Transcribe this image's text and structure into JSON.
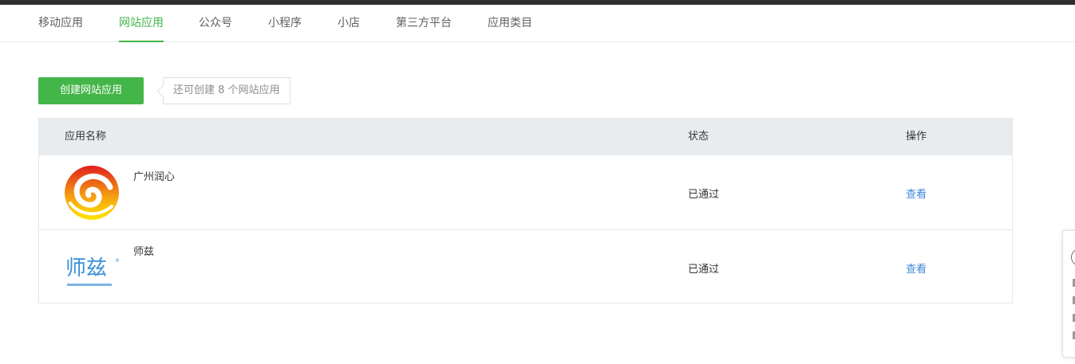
{
  "nav": {
    "tabs": [
      {
        "label": "移动应用",
        "active": false
      },
      {
        "label": "网站应用",
        "active": true
      },
      {
        "label": "公众号",
        "active": false
      },
      {
        "label": "小程序",
        "active": false
      },
      {
        "label": "小店",
        "active": false
      },
      {
        "label": "第三方平台",
        "active": false
      },
      {
        "label": "应用类目",
        "active": false
      }
    ]
  },
  "toolbar": {
    "create_label": "创建网站应用",
    "tip": "还可创建 8 个网站应用"
  },
  "table": {
    "headers": {
      "name": "应用名称",
      "status": "状态",
      "action": "操作"
    },
    "rows": [
      {
        "name": "广州润心",
        "logo": "runxin-logo",
        "status": "已通过",
        "action": "查看"
      },
      {
        "name": "师兹",
        "logo": "shizi-logo",
        "logo_text": "师兹",
        "status": "已通过",
        "action": "查看"
      }
    ]
  },
  "colors": {
    "accent": "#44b549",
    "link": "#3f87d9",
    "header_bg": "#e9ecee",
    "top_strip": "#2e2e2e"
  }
}
